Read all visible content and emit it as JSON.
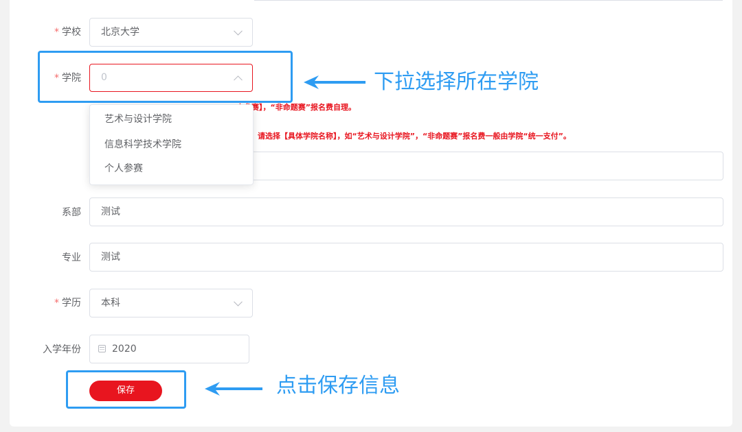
{
  "form": {
    "school": {
      "label": "学校",
      "required_mark": "*",
      "value": "北京大学"
    },
    "college": {
      "label": "学院",
      "required_mark": "*",
      "value": "0"
    },
    "college_hint_1": "人参赛】，“非命题赛”报名费自理。",
    "college_hint_2": "，请选择【具体学院名称】，如“艺术与设计学院”，“非命题赛”报名费一般由学院“统一支付”。",
    "college_options": [
      "艺术与设计学院",
      "信息科学技术学院",
      "个人参赛"
    ],
    "department": {
      "label": "系部",
      "value": "测试"
    },
    "major": {
      "label": "专业",
      "value": "测试"
    },
    "education": {
      "label": "学历",
      "required_mark": "*",
      "value": "本科"
    },
    "enroll_year": {
      "label": "入学年份",
      "value": "2020",
      "icon": "calendar-icon"
    },
    "save_label": "保存"
  },
  "annotations": {
    "college_tip": "下拉选择所在学院",
    "save_tip": "点击保存信息"
  },
  "colors": {
    "accent_red": "#e8151f",
    "annotation_blue": "#2e9cf2"
  }
}
